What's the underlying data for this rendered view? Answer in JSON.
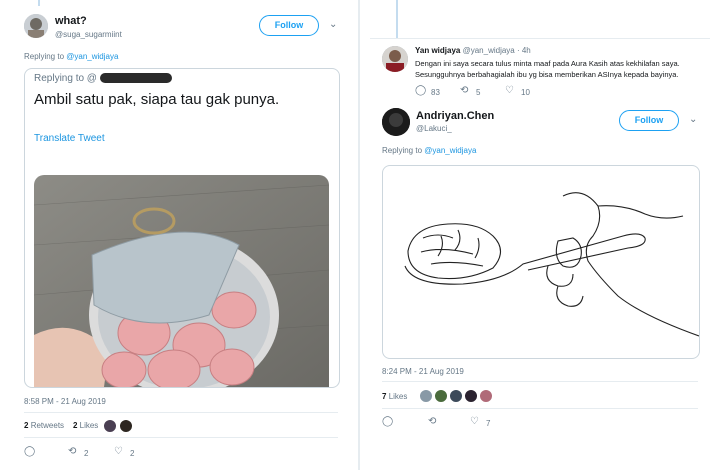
{
  "left": {
    "user": {
      "name": "what?",
      "handle": "@suga_sugarmiint"
    },
    "follow_label": "Follow",
    "replying_prefix": "Replying to",
    "replying_to": "@yan_widjaya",
    "quote": {
      "replying_prefix": "Replying to @",
      "text": "Ambil satu pak, siapa tau gak punya.",
      "translate": "Translate Tweet"
    },
    "timestamp": "8:58 PM - 21 Aug 2019",
    "retweets_count": "2",
    "retweets_label": "Retweets",
    "likes_count": "2",
    "likes_label": "Likes",
    "action_retweet_count": "2",
    "action_like_count": "2"
  },
  "right": {
    "parent": {
      "name": "Yan widjaya",
      "handle_time": "@yan_widjaya · 4h",
      "text_line1": "Dengan ini saya secara tulus minta maaf pada Aura Kasih atas kekhilafan saya.",
      "text_line2": "Sesungguhnya berbahagialah ibu yg bisa memberikan ASInya kepada bayinya.",
      "reply_count": "83",
      "retweet_count": "5",
      "like_count": "10"
    },
    "user": {
      "name": "Andriyan.Chen",
      "handle": "@Lakuci_"
    },
    "follow_label": "Follow",
    "replying_prefix": "Replying to",
    "replying_to": "@yan_widjaya",
    "timestamp": "8:24 PM - 21 Aug 2019",
    "likes_count": "7",
    "likes_label": "Likes",
    "action_like_count": "7"
  },
  "icons": {
    "reply": "reply-icon",
    "retweet": "retweet-icon",
    "like": "heart-icon",
    "chevron": "chevron-down-icon"
  },
  "colors": {
    "accent": "#1da1f2",
    "muted": "#657786"
  }
}
